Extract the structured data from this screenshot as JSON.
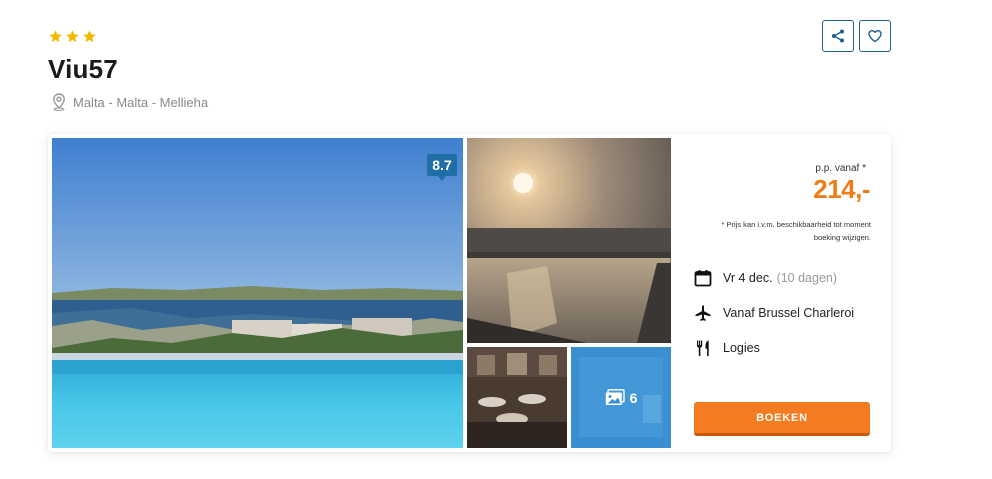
{
  "hotel": {
    "stars": 3,
    "name": "Viu57",
    "location": "Malta - Malta - Mellieha"
  },
  "actions": {
    "share_icon": "share-icon",
    "favorite_icon": "heart-icon"
  },
  "gallery": {
    "rating": "8.7",
    "more_count": "6"
  },
  "offer": {
    "price_label": "p.p. vanaf *",
    "price": "214,-",
    "disclaimer": "* Prijs kan i.v.m. beschikbaarheid tot moment boeking wijzigen.",
    "date": "Vr 4 dec.",
    "duration": "(10 dagen)",
    "departure": "Vanaf Brussel Charleroi",
    "board": "Logies",
    "book_label": "BOEKEN"
  },
  "colors": {
    "accent": "#f47b20",
    "price": "#f07c16",
    "brand_blue": "#1f6ea6",
    "star": "#f5b800"
  }
}
